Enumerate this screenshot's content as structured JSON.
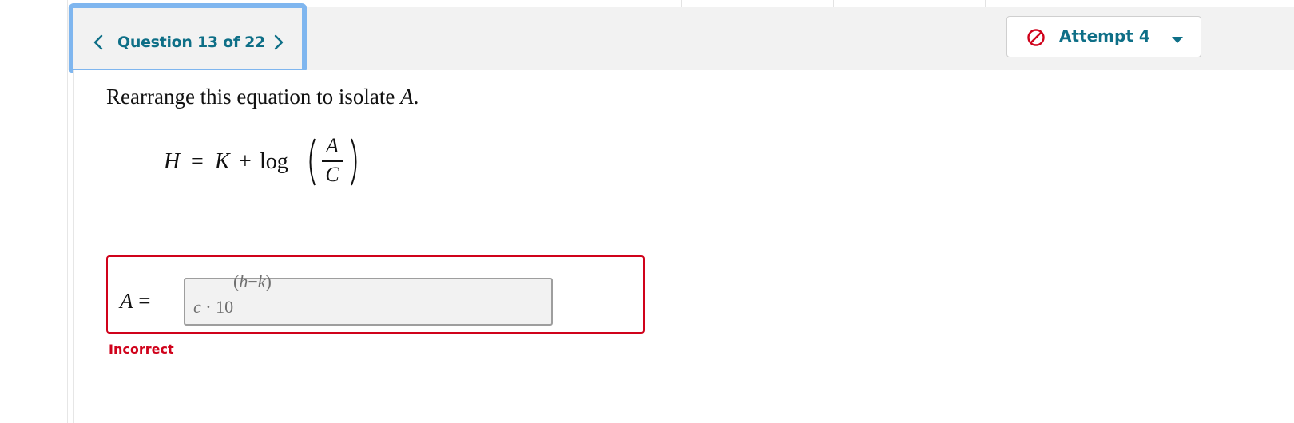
{
  "header": {
    "question_label": "Question 13 of 22",
    "attempt_label": "Attempt 4"
  },
  "question": {
    "prompt_text": "Rearrange this equation to isolate ",
    "prompt_var": "A",
    "prompt_end": ".",
    "equation": {
      "lhs": "H",
      "equals": "=",
      "k": "K",
      "plus": "+",
      "log": "log",
      "numerator": "A",
      "denominator": "C"
    }
  },
  "answer": {
    "label_var": "A",
    "label_equals": "=",
    "value_base": "c",
    "value_dot": "·",
    "value_ten": "10",
    "value_exponent_open": "(",
    "value_exponent_h": "h",
    "value_exponent_minus": "−",
    "value_exponent_k": "k",
    "value_exponent_close": ")",
    "feedback": "Incorrect"
  },
  "colors": {
    "teal": "#0e6f87",
    "error_red": "#d0021b",
    "focus_blue": "#7fb6ef"
  },
  "icons": {
    "prev": "chevron-left-icon",
    "next": "chevron-right-icon",
    "attempt": "no-entry-icon",
    "dropdown": "caret-down-icon"
  }
}
